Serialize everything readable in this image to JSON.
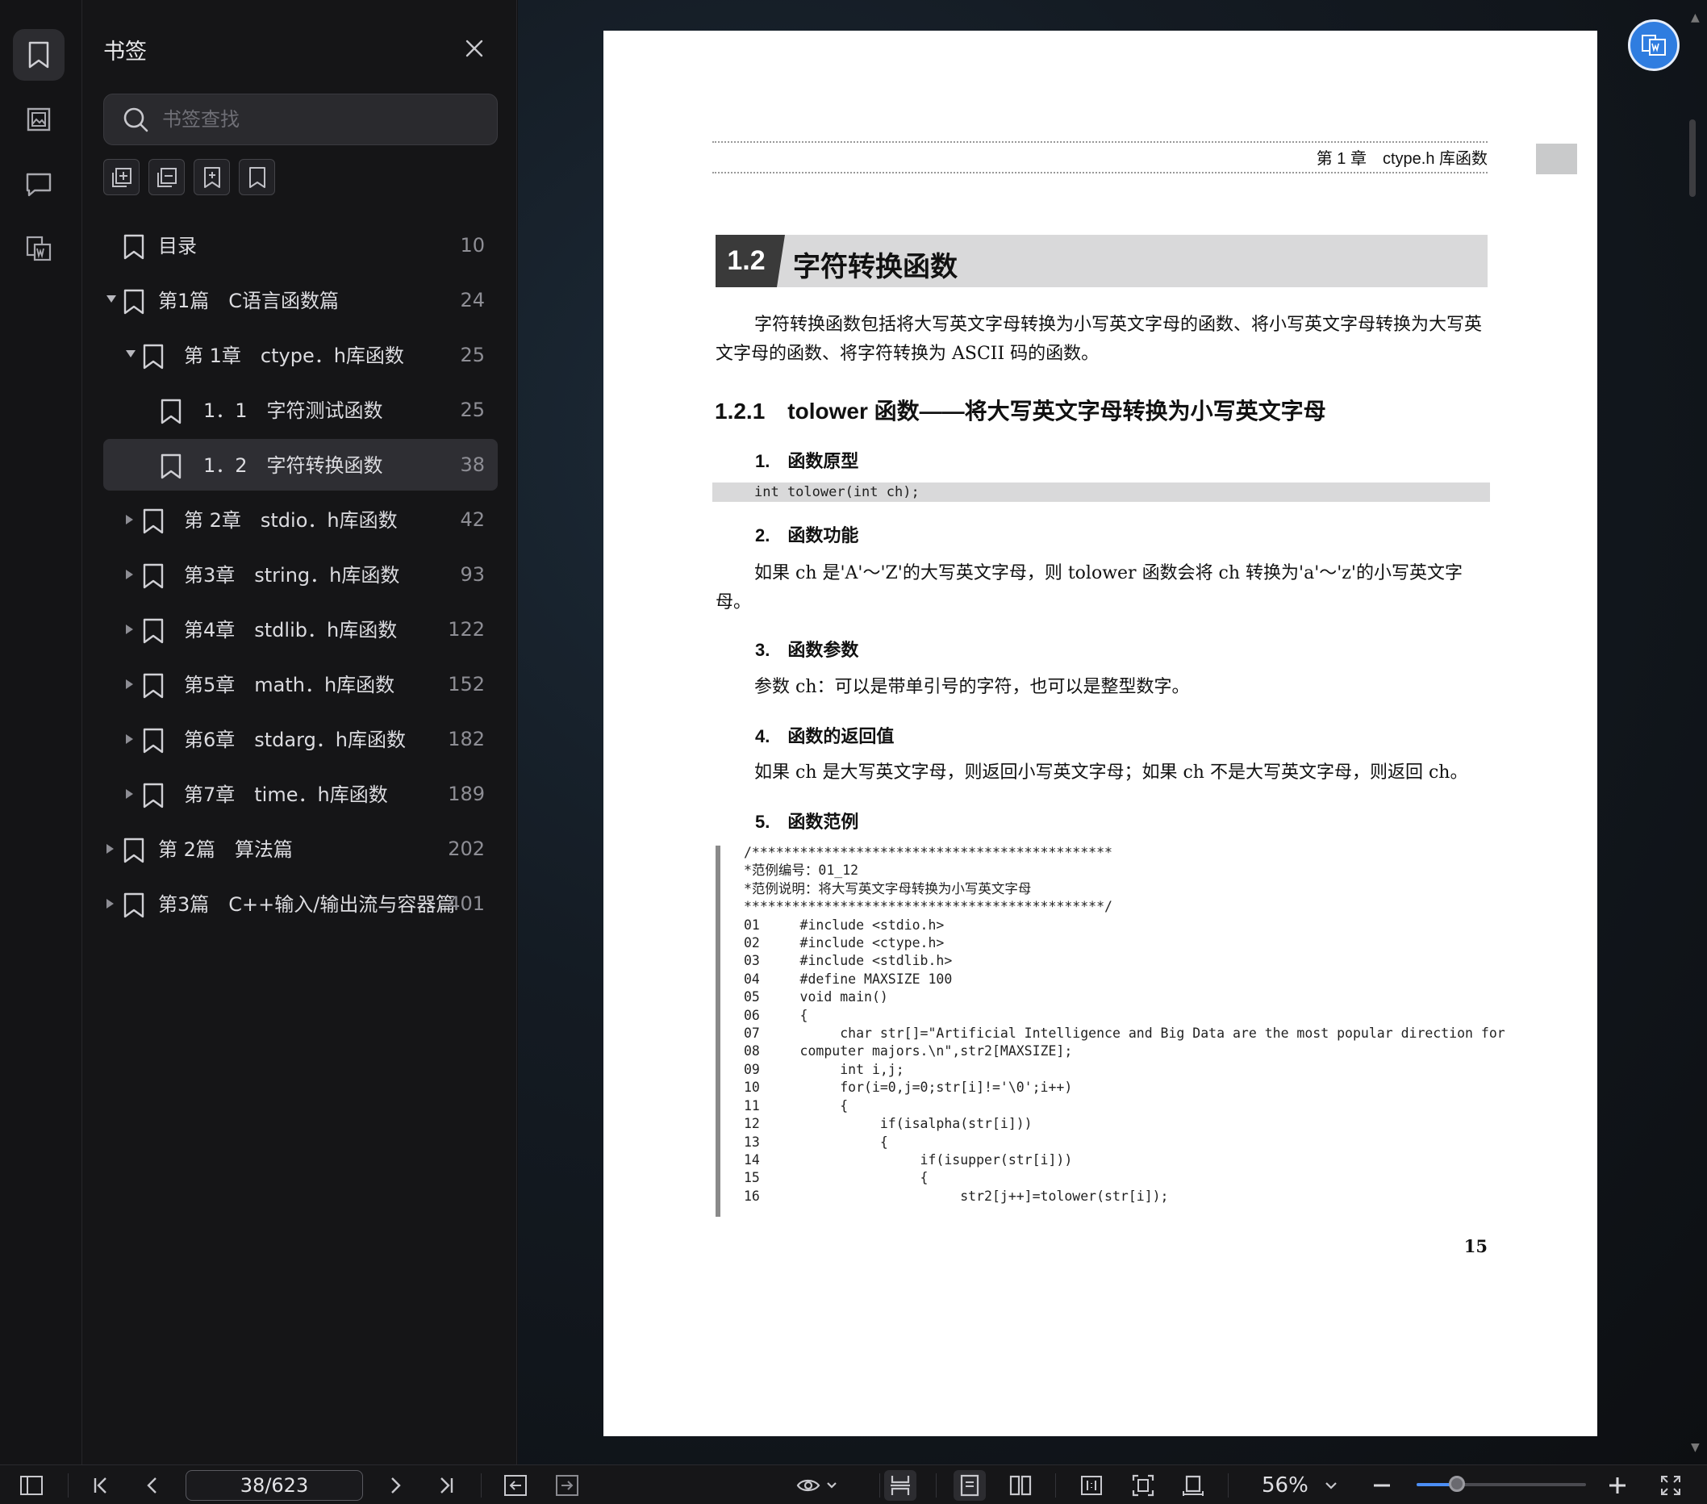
{
  "sidebar_panel": {
    "title": "书签",
    "search_placeholder": "书签查找"
  },
  "bookmarks": [
    {
      "label": "目录",
      "page": "10",
      "level": 0,
      "caret": "none",
      "selected": false
    },
    {
      "label": "第1篇　C语言函数篇",
      "page": "24",
      "level": 0,
      "caret": "down",
      "selected": false
    },
    {
      "label": "第 1章　ctype．h库函数",
      "page": "25",
      "level": 1,
      "caret": "down",
      "selected": false
    },
    {
      "label": "1．1　字符测试函数",
      "page": "25",
      "level": 2,
      "caret": "none",
      "selected": false
    },
    {
      "label": "1．2　字符转换函数",
      "page": "38",
      "level": 2,
      "caret": "none",
      "selected": true
    },
    {
      "label": "第 2章　stdio．h库函数",
      "page": "42",
      "level": 1,
      "caret": "right",
      "selected": false
    },
    {
      "label": "第3章　string．h库函数",
      "page": "93",
      "level": 1,
      "caret": "right",
      "selected": false
    },
    {
      "label": "第4章　stdlib．h库函数",
      "page": "122",
      "level": 1,
      "caret": "right",
      "selected": false
    },
    {
      "label": "第5章　math．h库函数",
      "page": "152",
      "level": 1,
      "caret": "right",
      "selected": false
    },
    {
      "label": "第6章　stdarg．h库函数",
      "page": "182",
      "level": 1,
      "caret": "right",
      "selected": false
    },
    {
      "label": "第7章　time．h库函数",
      "page": "189",
      "level": 1,
      "caret": "right",
      "selected": false
    },
    {
      "label": "第 2篇　算法篇",
      "page": "202",
      "level": 0,
      "caret": "right",
      "selected": false
    },
    {
      "label": "第3篇　C++输入/输出流与容器篇",
      "page": "401",
      "level": 0,
      "caret": "right",
      "selected": false
    }
  ],
  "document": {
    "running_header": "第 1 章　ctype.h 库函数",
    "section_number": "1.2",
    "section_title": "字符转换函数",
    "intro": "字符转换函数包括将大写英文字母转换为小写英文字母的函数、将小写英文字母转换为大写英文字母的函数、将字符转换为 ASCII 码的函数。",
    "subsection": "1.2.1　tolower 函数——将大写英文字母转换为小写英文字母",
    "h1": "1.　函数原型",
    "prototype": "int tolower(int ch);",
    "h2": "2.　函数功能",
    "p2": "如果 ch 是'A'～'Z'的大写英文字母，则 tolower 函数会将 ch 转换为'a'～'z'的小写英文字母。",
    "h3": "3.　函数参数",
    "p3": "参数 ch：可以是带单引号的字符，也可以是整型数字。",
    "h4": "4.　函数的返回值",
    "p4": "如果 ch 是大写英文字母，则返回小写英文字母；如果 ch 不是大写英文字母，则返回 ch。",
    "h5": "5.　函数范例",
    "code": "/*********************************************\n*范例编号：01_12\n*范例说明：将大写英文字母转换为小写英文字母\n*********************************************/\n01     #include <stdio.h>\n02     #include <ctype.h>\n03     #include <stdlib.h>\n04     #define MAXSIZE 100\n05     void main()\n06     {\n07          char str[]=\"Artificial Intelligence and Big Data are the most popular direction for\n08     computer majors.\\n\",str2[MAXSIZE];\n09          int i,j;\n10          for(i=0,j=0;str[i]!='\\0';i++)\n11          {\n12               if(isalpha(str[i]))\n13               {\n14                    if(isupper(str[i]))\n15                    {\n16                         str2[j++]=tolower(str[i]);",
    "page_number": "15"
  },
  "toolbar": {
    "page_indicator": "38/623",
    "zoom": "56%",
    "zoom_fraction": 0.24
  },
  "colors": {
    "accent": "#2f7de0",
    "slider_fill": "#4c8ef5",
    "selected_row": "#2e2e33"
  }
}
